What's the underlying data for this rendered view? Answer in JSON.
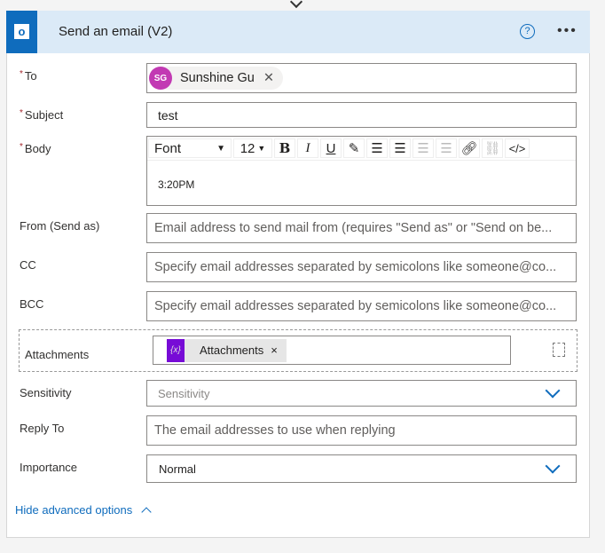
{
  "header": {
    "title": "Send an email (V2)",
    "app_icon": "outlook-icon",
    "help_icon": "help-icon",
    "more_icon": "more-icon"
  },
  "fields": {
    "to": {
      "label": "To",
      "required": "*",
      "recipient_initials": "SG",
      "recipient_name": "Sunshine Gu",
      "avatar_color": "#c239b3"
    },
    "subject": {
      "label": "Subject",
      "required": "*",
      "value": "test"
    },
    "body": {
      "label": "Body",
      "required": "*",
      "font": "Font",
      "size": "12",
      "content": "3:20PM"
    },
    "from": {
      "label": "From (Send as)",
      "placeholder": "Email address to send mail from (requires \"Send as\" or \"Send on be..."
    },
    "cc": {
      "label": "CC",
      "placeholder": "Specify email addresses separated by semicolons like someone@co..."
    },
    "bcc": {
      "label": "BCC",
      "placeholder": "Specify email addresses separated by semicolons like someone@co..."
    },
    "attachments": {
      "label": "Attachments",
      "token": "Attachments",
      "token_icon": "{x}",
      "token_color": "#770bd6"
    },
    "sensitivity": {
      "label": "Sensitivity",
      "placeholder": "Sensitivity"
    },
    "reply_to": {
      "label": "Reply To",
      "placeholder": "The email addresses to use when replying"
    },
    "importance": {
      "label": "Importance",
      "value": "Normal"
    }
  },
  "footer": {
    "toggle": "Hide advanced options"
  },
  "colors": {
    "accent": "#0f6cbd",
    "header_bg": "#dbeaf7"
  }
}
